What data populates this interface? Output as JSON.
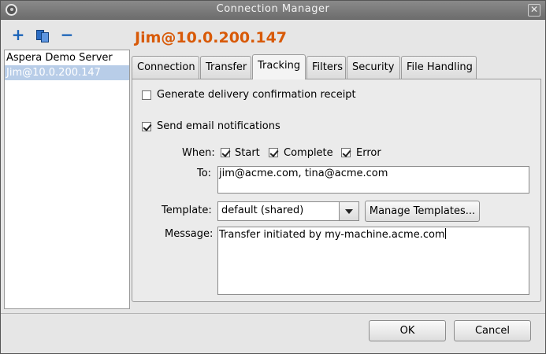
{
  "window": {
    "title": "Connection Manager"
  },
  "toolbar": {
    "add_icon": "plus-icon",
    "duplicate_icon": "copy-icon",
    "remove_icon": "minus-icon"
  },
  "servers": [
    {
      "label": "Aspera Demo Server",
      "selected": false
    },
    {
      "label": "Jim@10.0.200.147",
      "selected": true
    }
  ],
  "header": {
    "host_title": "Jim@10.0.200.147",
    "accent_color": "#d85a08"
  },
  "tabs": [
    {
      "label": "Connection",
      "active": false
    },
    {
      "label": "Transfer",
      "active": false
    },
    {
      "label": "Tracking",
      "active": true
    },
    {
      "label": "Filters",
      "active": false
    },
    {
      "label": "Security",
      "active": false
    },
    {
      "label": "File Handling",
      "active": false
    }
  ],
  "tracking": {
    "delivery_receipt": {
      "label": "Generate delivery confirmation receipt",
      "checked": false
    },
    "email_notifications": {
      "label": "Send email notifications",
      "checked": true
    },
    "when_label": "When:",
    "when": [
      {
        "label": "Start",
        "checked": true
      },
      {
        "label": "Complete",
        "checked": true
      },
      {
        "label": "Error",
        "checked": true
      }
    ],
    "to_label": "To:",
    "to_value": "jim@acme.com, tina@acme.com",
    "template_label": "Template:",
    "template_value": "default (shared)",
    "manage_templates": "Manage Templates...",
    "message_label": "Message:",
    "message_value": "Transfer initiated by my-machine.acme.com"
  },
  "footer": {
    "ok": "OK",
    "cancel": "Cancel"
  }
}
